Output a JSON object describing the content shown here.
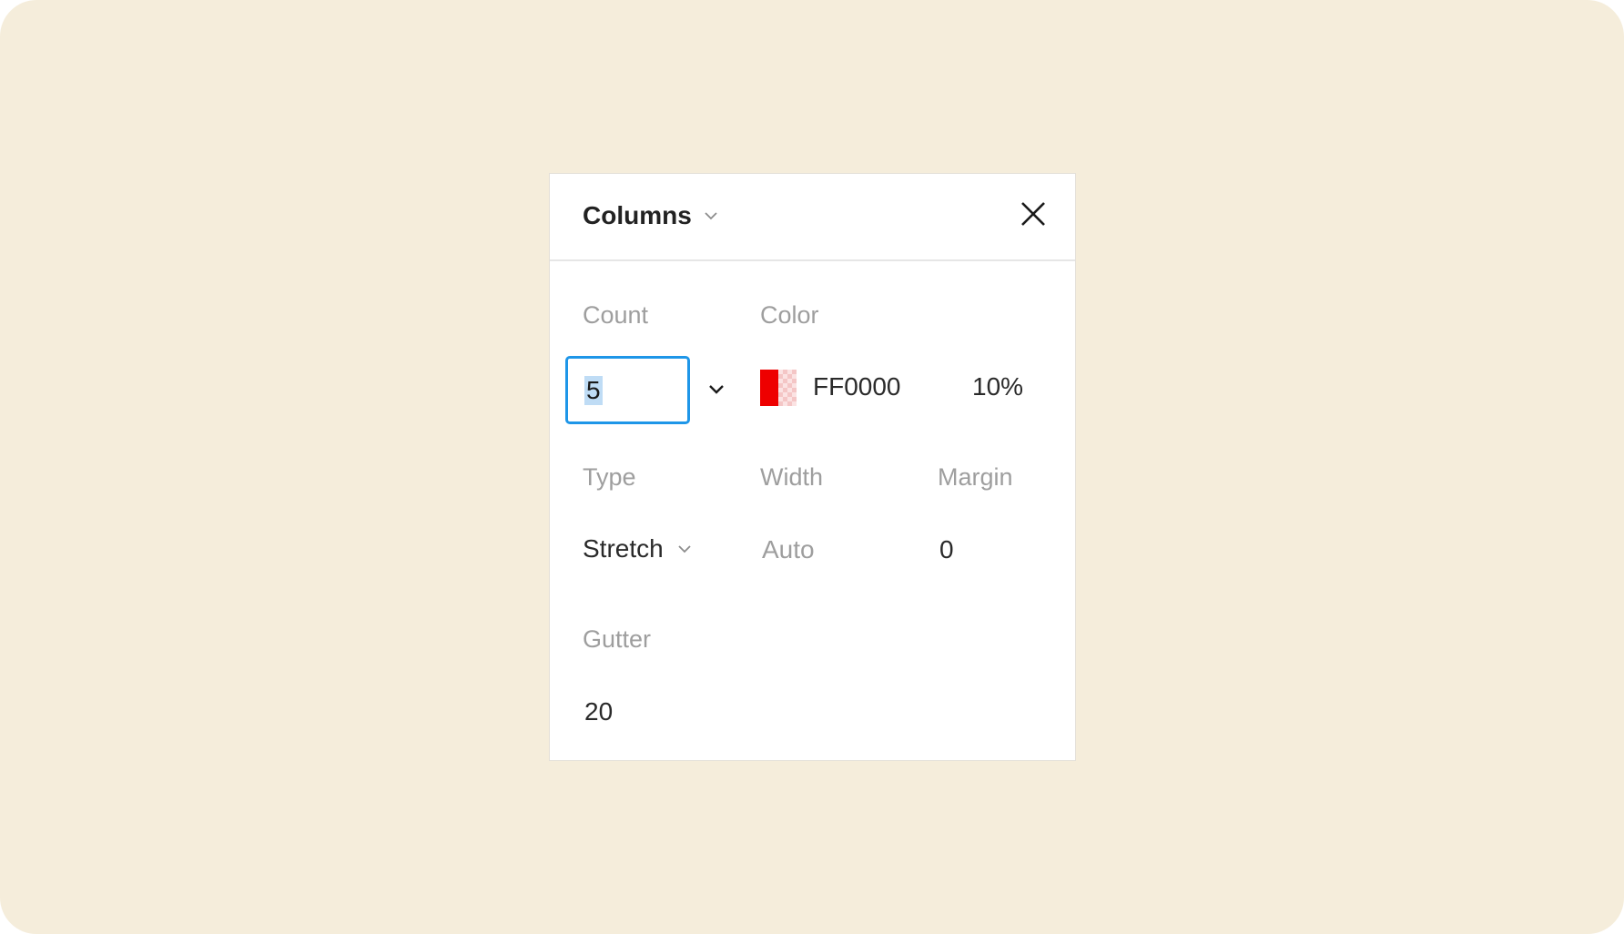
{
  "panel": {
    "title": "Columns",
    "count": {
      "label": "Count",
      "value": "5"
    },
    "color": {
      "label": "Color",
      "hex": "FF0000",
      "opacity": "10%",
      "swatch_color": "#ee0000"
    },
    "type": {
      "label": "Type",
      "value": "Stretch"
    },
    "width": {
      "label": "Width",
      "value": "Auto"
    },
    "margin": {
      "label": "Margin",
      "value": "0"
    },
    "gutter": {
      "label": "Gutter",
      "value": "20"
    }
  },
  "icons": {
    "title_chevron": "chevron-down-icon",
    "close": "close-icon",
    "count_chevron": "chevron-down-icon",
    "type_chevron": "chevron-down-icon"
  },
  "colors": {
    "background": "#f5eddb",
    "focus_border": "#1e96e8",
    "selection": "#bfdcf5"
  }
}
